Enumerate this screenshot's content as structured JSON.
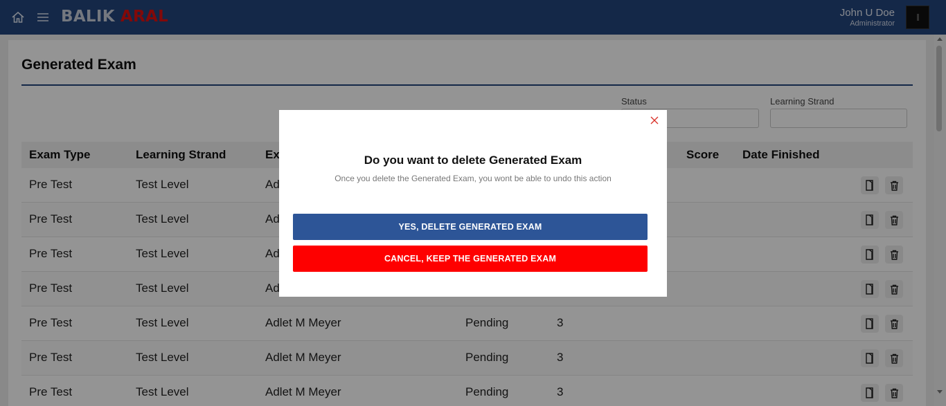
{
  "header": {
    "brand_part1": "BALIK",
    "brand_part2": "ARAL",
    "user_name": "John U Doe",
    "user_role": "Administrator",
    "colors": {
      "bar": "#24457d",
      "brand_accent": "#e01010"
    }
  },
  "page": {
    "title": "Generated Exam",
    "filters": {
      "status_label": "Status",
      "status_value": "",
      "strand_label": "Learning Strand",
      "strand_value": ""
    }
  },
  "table": {
    "columns": [
      "Exam Type",
      "Learning Strand",
      "Ex",
      "",
      "",
      "Score",
      "Date Finished"
    ],
    "rows": [
      {
        "exam_type": "Pre Test",
        "strand": "Test Level",
        "examinee": "Ad",
        "status": "",
        "items": ""
      },
      {
        "exam_type": "Pre Test",
        "strand": "Test Level",
        "examinee": "Ad",
        "status": "",
        "items": ""
      },
      {
        "exam_type": "Pre Test",
        "strand": "Test Level",
        "examinee": "Ad",
        "status": "",
        "items": ""
      },
      {
        "exam_type": "Pre Test",
        "strand": "Test Level",
        "examinee": "Ad",
        "status": "",
        "items": ""
      },
      {
        "exam_type": "Pre Test",
        "strand": "Test Level",
        "examinee": "Adlet M Meyer",
        "status": "Pending",
        "items": "3"
      },
      {
        "exam_type": "Pre Test",
        "strand": "Test Level",
        "examinee": "Adlet M Meyer",
        "status": "Pending",
        "items": "3"
      },
      {
        "exam_type": "Pre Test",
        "strand": "Test Level",
        "examinee": "Adlet M Meyer",
        "status": "Pending",
        "items": "3"
      }
    ],
    "row_action_icons": [
      "view-icon",
      "trash-icon"
    ]
  },
  "modal": {
    "title": "Do you want to delete Generated Exam",
    "subtitle": "Once you delete the Generated Exam, you wont be able to undo this action",
    "confirm_label": "YES, DELETE GENERATED EXAM",
    "cancel_label": "CANCEL, KEEP THE GENERATED EXAM",
    "colors": {
      "confirm": "#2d5597",
      "cancel": "#fe0000",
      "close": "#d9322a"
    }
  }
}
